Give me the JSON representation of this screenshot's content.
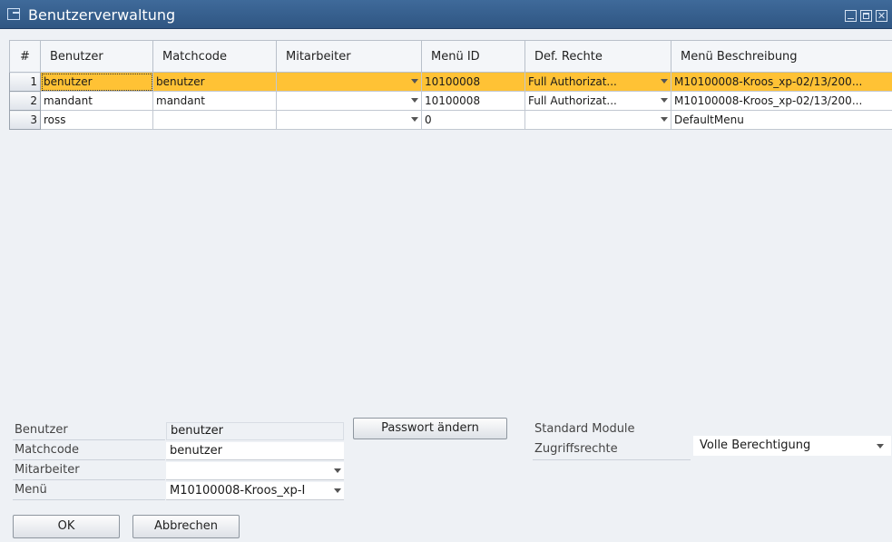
{
  "window": {
    "title": "Benutzerverwaltung"
  },
  "grid": {
    "columns": [
      "#",
      "Benutzer",
      "Matchcode",
      "Mitarbeiter",
      "Menü ID",
      "Def. Rechte",
      "Menü Beschreibung"
    ],
    "rows": [
      {
        "num": "1",
        "benutzer": "benutzer",
        "matchcode": "benutzer",
        "mitarbeiter": "",
        "menu_id": "10100008",
        "rechte": "Full Authorizat...",
        "beschreibung": "M10100008-Kroos_xp-02/13/200..."
      },
      {
        "num": "2",
        "benutzer": "mandant",
        "matchcode": "mandant",
        "mitarbeiter": "",
        "menu_id": "10100008",
        "rechte": "Full Authorizat...",
        "beschreibung": "M10100008-Kroos_xp-02/13/200..."
      },
      {
        "num": "3",
        "benutzer": "ross",
        "matchcode": "",
        "mitarbeiter": "",
        "menu_id": "0",
        "rechte": "",
        "beschreibung": "DefaultMenu"
      }
    ]
  },
  "form": {
    "benutzer_label": "Benutzer",
    "benutzer_value": "benutzer",
    "matchcode_label": "Matchcode",
    "matchcode_value": "benutzer",
    "mitarbeiter_label": "Mitarbeiter",
    "mitarbeiter_value": "",
    "menu_label": "Menü",
    "menu_value": "M10100008-Kroos_xp-I",
    "password_button": "Passwort ändern",
    "module_label_1": "Standard Module",
    "module_label_2": "Zugriffsrechte",
    "module_value": "Volle Berechtigung"
  },
  "buttons": {
    "ok": "OK",
    "cancel": "Abbrechen"
  },
  "colors": {
    "title_bar": "#3a6394",
    "selected_row": "#ffc235"
  }
}
